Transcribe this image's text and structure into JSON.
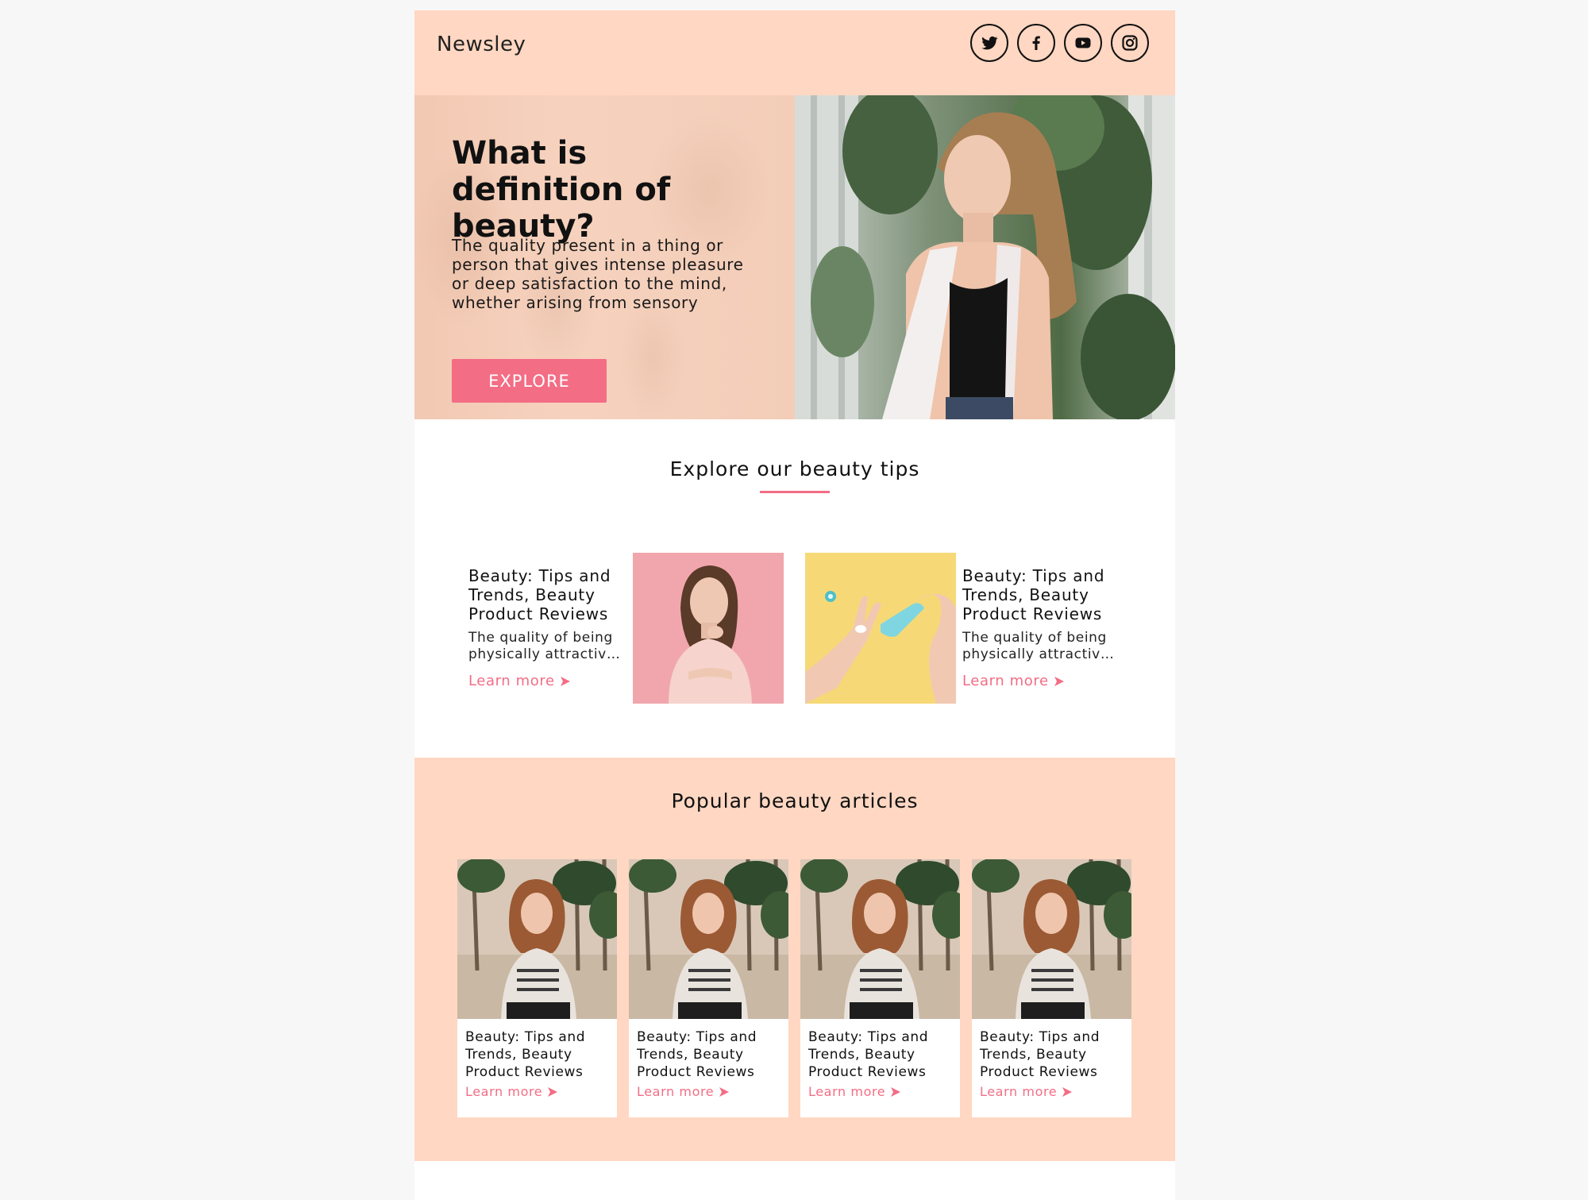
{
  "header": {
    "brand": "Newsley",
    "socials": [
      {
        "icon": "twitter-icon"
      },
      {
        "icon": "facebook-icon"
      },
      {
        "icon": "youtube-icon"
      },
      {
        "icon": "instagram-icon"
      }
    ]
  },
  "hero": {
    "title": "What is definition of beauty?",
    "text": "The quality present in a thing or person that gives intense pleasure or deep satisfaction to the mind, whether arising from sensory",
    "button_label": "EXPLORE"
  },
  "tips": {
    "title": "Explore our beauty tips",
    "items": [
      {
        "title": "Beauty: Tips and Trends, Beauty Product Reviews",
        "desc": "The quality of being physically attractiv…",
        "link": "Learn more"
      },
      {
        "title": "Beauty: Tips and Trends, Beauty Product Reviews",
        "desc": "The quality of being physically attractiv…",
        "link": "Learn more"
      }
    ]
  },
  "popular": {
    "title": "Popular beauty articles",
    "cards": [
      {
        "title": "Beauty: Tips and Trends, Beauty Product Reviews",
        "link": "Learn more"
      },
      {
        "title": "Beauty: Tips and Trends, Beauty Product Reviews",
        "link": "Learn more"
      },
      {
        "title": "Beauty: Tips and Trends, Beauty Product Reviews",
        "link": "Learn more"
      },
      {
        "title": "Beauty: Tips and Trends, Beauty Product Reviews",
        "link": "Learn more"
      }
    ]
  },
  "colors": {
    "peach": "#ffd7c2",
    "accent": "#f36d85",
    "background": "#f7f7f7"
  }
}
